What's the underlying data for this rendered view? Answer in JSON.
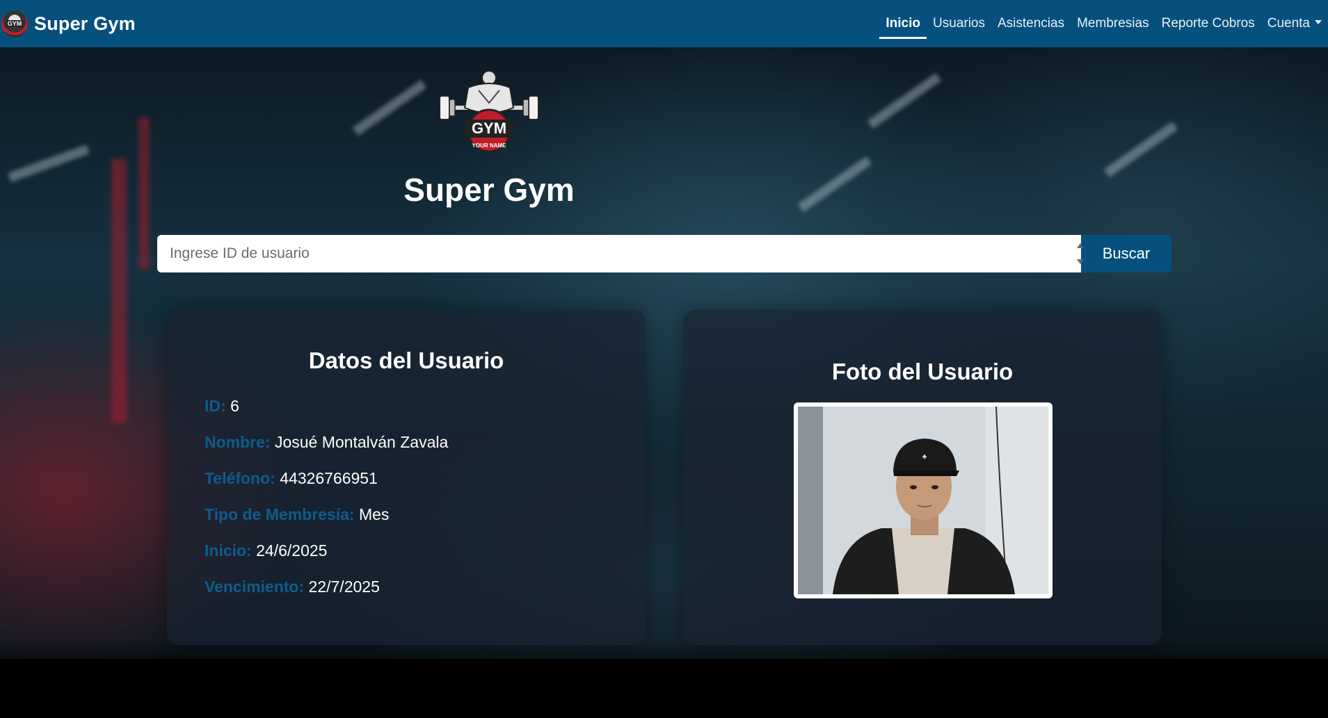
{
  "navbar": {
    "brand": "Super Gym",
    "links": [
      {
        "label": "Inicio",
        "active": true
      },
      {
        "label": "Usuarios"
      },
      {
        "label": "Asistencias"
      },
      {
        "label": "Membresias"
      },
      {
        "label": "Reporte Cobros"
      },
      {
        "label": "Cuenta",
        "dropdown": true
      }
    ]
  },
  "hero": {
    "logo_text": "GYM",
    "logo_subtext": "YOUR NAME",
    "title": "Super Gym"
  },
  "search": {
    "placeholder": "Ingrese ID de usuario",
    "value": "",
    "button_label": "Buscar"
  },
  "user_card": {
    "title": "Datos del Usuario",
    "fields": [
      {
        "label": "ID:",
        "value": "6"
      },
      {
        "label": "Nombre:",
        "value": "Josué Montalván Zavala"
      },
      {
        "label": "Teléfono:",
        "value": "44326766951"
      },
      {
        "label": "Tipo de Membresía:",
        "value": "Mes"
      },
      {
        "label": "Inicio:",
        "value": "24/6/2025"
      },
      {
        "label": "Vencimiento:",
        "value": "22/7/2025"
      }
    ]
  },
  "photo_card": {
    "title": "Foto del Usuario",
    "cap_logo": "adidas-trefoil"
  },
  "colors": {
    "navbar": "#06507d",
    "button": "#06507d",
    "label": "#0f5c8d",
    "accent_red": "#c21d2a"
  }
}
